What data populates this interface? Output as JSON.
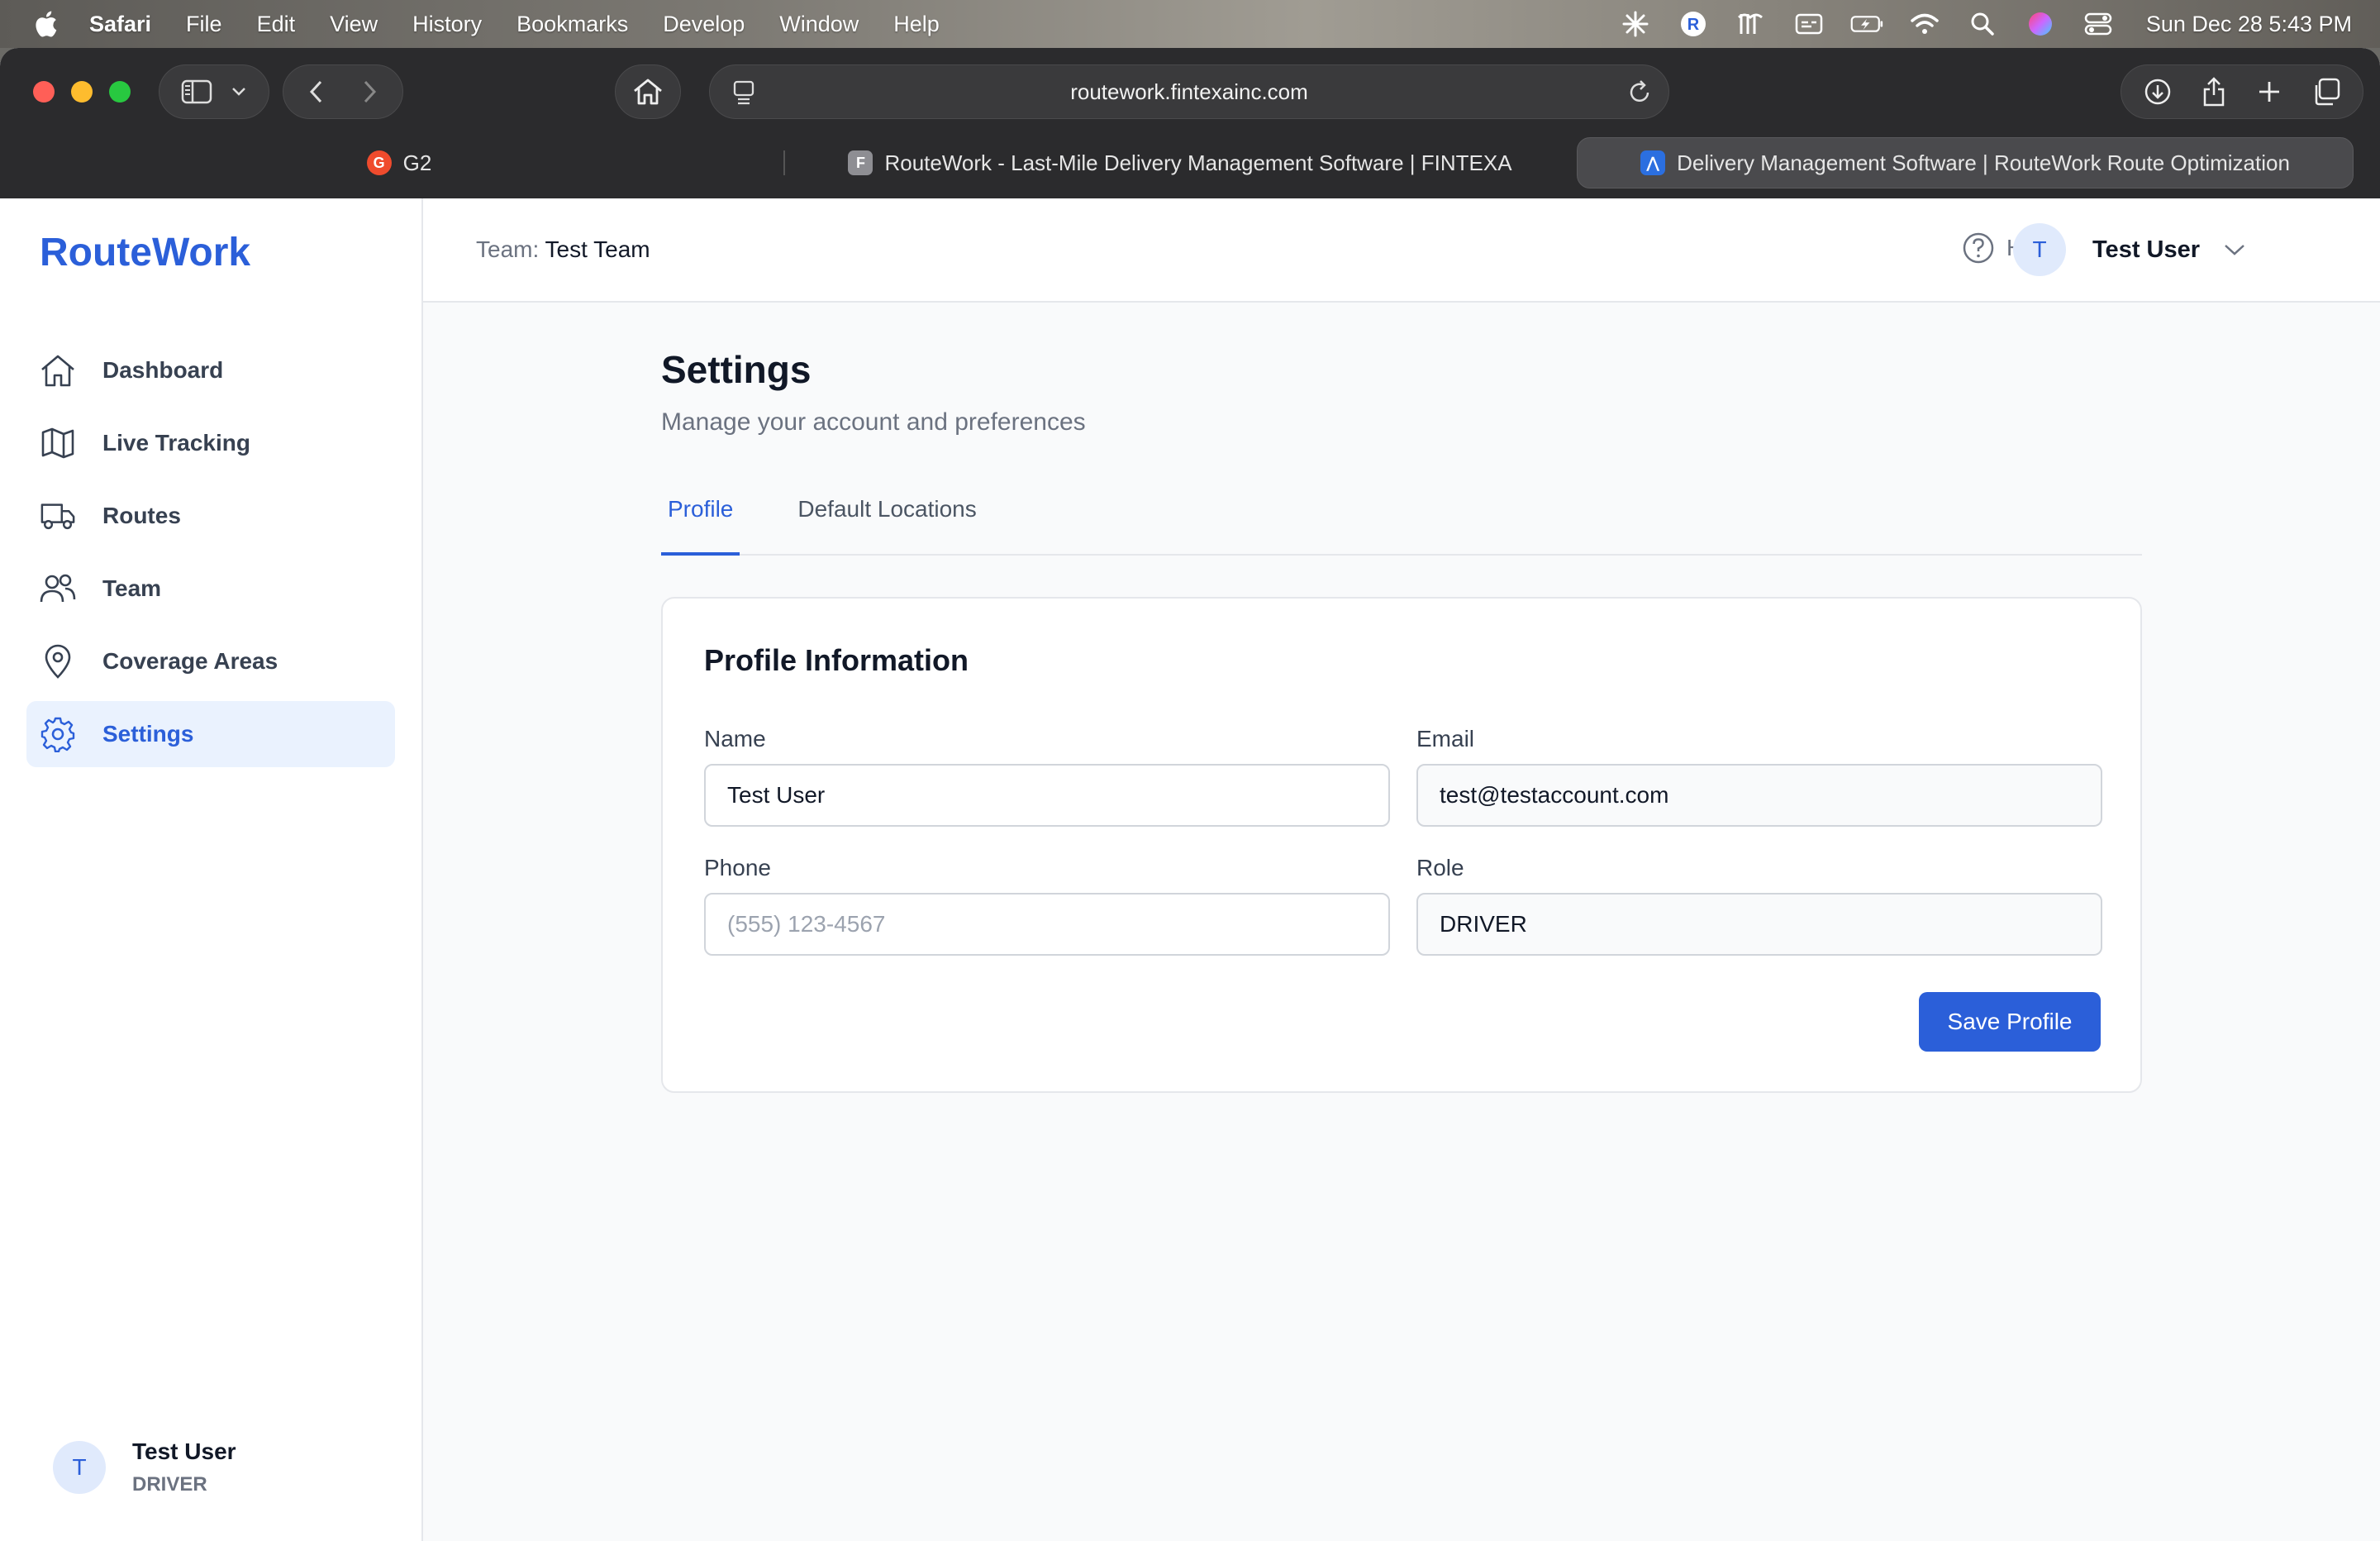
{
  "menubar": {
    "app": "Safari",
    "menus": [
      "File",
      "Edit",
      "View",
      "History",
      "Bookmarks",
      "Develop",
      "Window",
      "Help"
    ],
    "clock": "Sun Dec 28  5:43 PM"
  },
  "browser": {
    "url": "routework.fintexainc.com",
    "tabs": [
      {
        "title": "G2",
        "favicon": "G",
        "color": "#ef4b2d"
      },
      {
        "title": "RouteWork - Last-Mile Delivery Management Software | FINTEXA",
        "favicon": "F",
        "color": "#8e8e93"
      },
      {
        "title": "Delivery Management Software | RouteWork Route Optimization",
        "favicon": "⋀",
        "color": "#2b6fe0"
      }
    ]
  },
  "sidebar": {
    "brand": "RouteWork",
    "items": [
      {
        "label": "Dashboard",
        "icon": "home-icon"
      },
      {
        "label": "Live Tracking",
        "icon": "map-icon"
      },
      {
        "label": "Routes",
        "icon": "truck-icon"
      },
      {
        "label": "Team",
        "icon": "users-icon"
      },
      {
        "label": "Coverage Areas",
        "icon": "pin-icon"
      },
      {
        "label": "Settings",
        "icon": "gear-icon"
      }
    ],
    "user": {
      "initial": "T",
      "name": "Test User",
      "role": "DRIVER"
    }
  },
  "topbar": {
    "team_label": "Team:",
    "team_name": "Test Team",
    "help": "Help",
    "user_initial": "T",
    "user_name": "Test User"
  },
  "page": {
    "title": "Settings",
    "subtitle": "Manage your account and preferences",
    "tabs": [
      "Profile",
      "Default Locations"
    ]
  },
  "profile": {
    "title": "Profile Information",
    "name_label": "Name",
    "name_value": "Test User",
    "email_label": "Email",
    "email_value": "test@testaccount.com",
    "phone_label": "Phone",
    "phone_placeholder": "(555) 123-4567",
    "role_label": "Role",
    "role_value": "DRIVER",
    "save_label": "Save Profile"
  },
  "colors": {
    "accent": "#2b5fd9",
    "accent_bg": "#eaf2fe"
  }
}
